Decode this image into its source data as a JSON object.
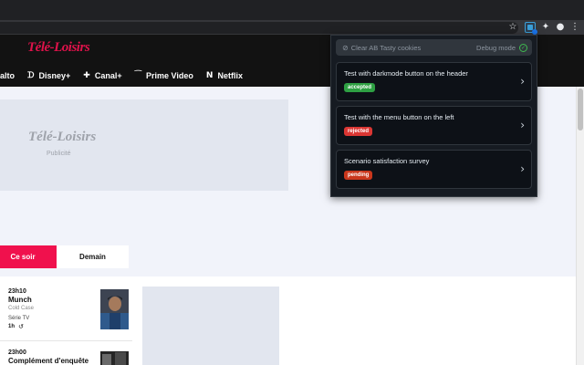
{
  "site": {
    "logo_text": "Télé-Loisirs",
    "nav": [
      {
        "label": "alto",
        "icon": ""
      },
      {
        "label": "Disney+",
        "icon": "disney-icon"
      },
      {
        "label": "Canal+",
        "icon": "canal-plus-icon"
      },
      {
        "label": "Prime Video",
        "icon": "prime-video-icon"
      },
      {
        "label": "Netflix",
        "icon": "netflix-icon"
      }
    ],
    "ad": {
      "logo_text": "Télé-Loisirs",
      "label": "Publicité"
    },
    "tabs": [
      {
        "label": "Ce soir",
        "active": true
      },
      {
        "label": "Demain",
        "active": false
      }
    ],
    "programs": [
      {
        "time": "23h10",
        "title": "Munch",
        "subtitle": "Cold Case",
        "genre": "Série TV",
        "duration": "1h",
        "icon": "replay-icon"
      },
      {
        "time": "23h00",
        "title": "Complément d'enquête"
      }
    ]
  },
  "popup": {
    "clear_label": "Clear AB Tasty cookies",
    "debug_label": "Debug mode",
    "tests": [
      {
        "title": "Test with darkmode button on the header",
        "status": "accepted",
        "status_color": "#2ea043"
      },
      {
        "title": "Test with the menu button on the left",
        "status": "rejected",
        "status_color": "#da3633"
      },
      {
        "title": "Scenario satisfaction survey",
        "status": "pending",
        "status_color": "#c9371c"
      }
    ]
  },
  "colors": {
    "brand": "#e0124b",
    "tab_active": "#f0114d",
    "popup_bg": "#161b22"
  }
}
